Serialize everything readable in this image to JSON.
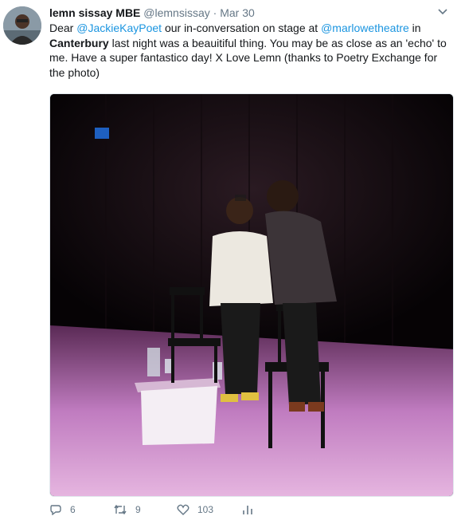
{
  "tweet": {
    "author_name": "lemn sissay MBE",
    "author_handle": "@lemnsissay",
    "separator": "·",
    "timestamp": "Mar 30",
    "text": {
      "t1": "Dear ",
      "m1": "@JackieKayPoet",
      "t2": "  our in-conversation on stage at ",
      "m2": "@marlowetheatre",
      "t3": " in ",
      "place": "Canterbury",
      "t4": "  last night was a beauitiful thing.   You may be as close as an  'echo' to me. Have a super fantastico day! X   Love Lemn (thanks to Poetry Exchange for the photo)"
    }
  },
  "actions": {
    "reply_count": "6",
    "retweet_count": "9",
    "like_count": "103"
  },
  "icons": {
    "avatar": "user-avatar",
    "caret": "chevron-down-icon",
    "reply": "reply-icon",
    "retweet": "retweet-icon",
    "like": "heart-icon",
    "analytics": "analytics-icon"
  },
  "colors": {
    "link": "#1b95e0",
    "muted": "#657786",
    "text": "#14171a"
  }
}
